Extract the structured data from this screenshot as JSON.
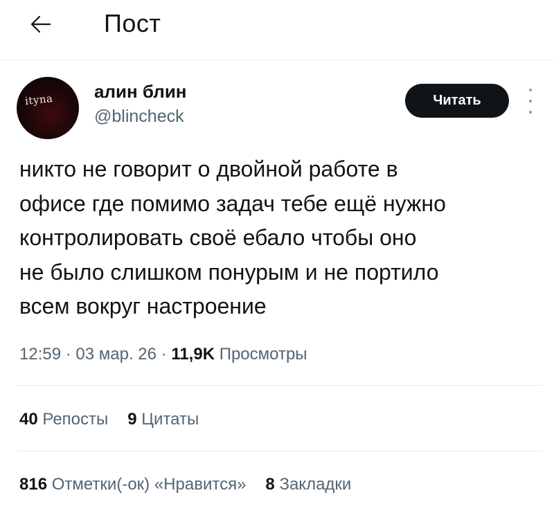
{
  "header": {
    "back_icon": "arrow-left-icon",
    "title": "Пост"
  },
  "author": {
    "avatar_text": "ityna",
    "name": "алин блин",
    "handle": "@blincheck"
  },
  "follow_button": {
    "label": "Читать"
  },
  "more_icon": "vertical-ellipsis-icon",
  "post": {
    "text": "никто не говорит о двойной работе в\nофисе где помимо задач тебе ещё нужно\nконтролировать своё ебало чтобы оно\nне было слишком понурым и не портило\nвсем вокруг настроение"
  },
  "meta": {
    "time": "12:59",
    "sep1": " · ",
    "date": "03 мар. 26",
    "sep2": " · ",
    "views_count": "11,9K",
    "views_label": "Просмотры"
  },
  "stats_row1": [
    {
      "count": "40",
      "label": "Репосты"
    },
    {
      "count": "9",
      "label": "Цитаты"
    }
  ],
  "stats_row2": [
    {
      "count": "816",
      "label": "Отметки(-ок) «Нравится»"
    },
    {
      "count": "8",
      "label": "Закладки"
    }
  ],
  "colors": {
    "text_primary": "#0f1419",
    "text_secondary": "#536471",
    "divider": "#e6e9eb",
    "button_bg": "#0f1419",
    "button_text": "#ffffff"
  }
}
